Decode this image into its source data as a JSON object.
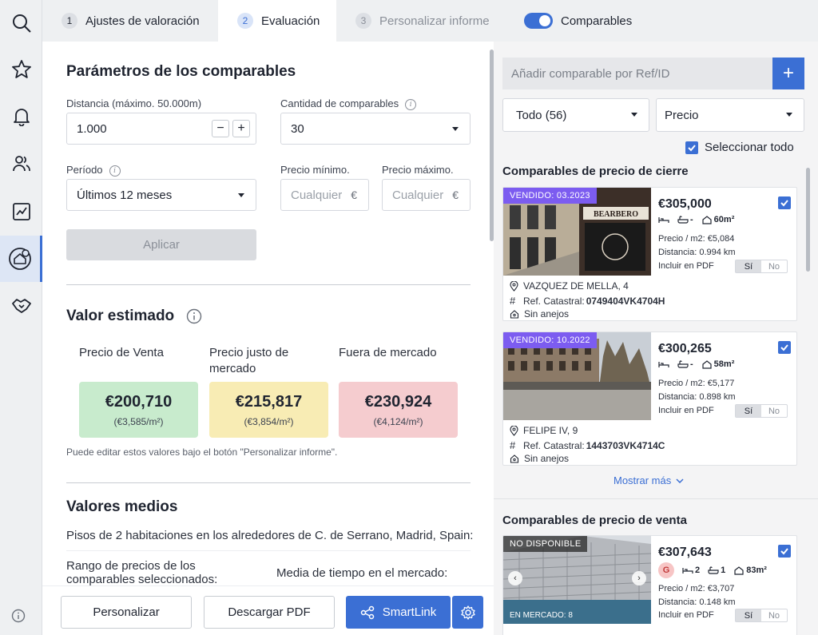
{
  "tabs": [
    {
      "num": "1",
      "label": "Ajustes de valoración"
    },
    {
      "num": "2",
      "label": "Evaluación"
    },
    {
      "num": "3",
      "label": "Personalizar informe"
    }
  ],
  "comparables_toggle": {
    "label": "Comparables",
    "on": true
  },
  "params": {
    "title": "Parámetros de los comparables",
    "distance_label": "Distancia (máximo. 50.000m)",
    "distance_value": "1.000",
    "count_label": "Cantidad de comparables",
    "count_value": "30",
    "period_label": "Período",
    "period_value": "Últimos 12 meses",
    "min_price_label": "Precio mínimo.",
    "max_price_label": "Precio máximo.",
    "min_price_placeholder": "Cualquier",
    "max_price_placeholder": "Cualquier",
    "currency": "€",
    "apply_label": "Aplicar"
  },
  "estimate": {
    "title": "Valor estimado",
    "columns": [
      {
        "label": "Precio de Venta",
        "value": "€200,710",
        "per_m2": "(€3,585/m²)",
        "color": "#c8ebcd"
      },
      {
        "label": "Precio justo de mercado",
        "value": "€215,817",
        "per_m2": "(€3,854/m²)",
        "color": "#f8ecb4"
      },
      {
        "label": "Fuera de mercado",
        "value": "€230,924",
        "per_m2": "(€4,124/m²)",
        "color": "#f5cccf"
      }
    ],
    "note": "Puede editar estos valores bajo el botón \"Personalizar informe\"."
  },
  "averages": {
    "title": "Valores medios",
    "subtitle": "Pisos de 2 habitaciones en los alrededores de C. de Serrano, Madrid, Spain:",
    "range_label": "Rango de precios de los comparables seleccionados:",
    "time_label": "Media de tiempo en el mercado:"
  },
  "footer": {
    "customize": "Personalizar",
    "download": "Descargar PDF",
    "smartlink": "SmartLink"
  },
  "right": {
    "add_placeholder": "Añadir comparable por Ref/ID",
    "filter_value": "Todo (56)",
    "sort_value": "Precio",
    "select_all": "Seleccionar todo",
    "closing_title": "Comparables de precio de cierre",
    "show_more": "Mostrar más",
    "sale_title": "Comparables de precio de venta",
    "pdf_label": "Incluir en PDF",
    "yes": "Sí",
    "no": "No",
    "closing_cards": [
      {
        "badge": "VENDIDO: 03.2023",
        "price": "€305,000",
        "beds": "",
        "baths": "-",
        "area": "60m²",
        "price_m2": "Precio / m2: €5,084",
        "distance": "Distancia: 0.994 km",
        "address": "VAZQUEZ DE MELLA, 4",
        "cadastral_label": "Ref. Catastral:",
        "cadastral": "0749404VK4704H",
        "annex": "Sin anejos",
        "sign": "BEARBERO"
      },
      {
        "badge": "VENDIDO: 10.2022",
        "price": "€300,265",
        "beds": "",
        "baths": "-",
        "area": "58m²",
        "price_m2": "Precio / m2: €5,177",
        "distance": "Distancia: 0.898 km",
        "address": "FELIPE IV, 9",
        "cadastral_label": "Ref. Catastral:",
        "cadastral": "1443703VK4714C",
        "annex": "Sin anejos"
      }
    ],
    "sale_cards": [
      {
        "badge": "NO DISPONIBLE",
        "price": "€307,643",
        "grade": "G",
        "beds": "2",
        "baths": "1",
        "area": "83m²",
        "price_m2": "Precio / m2: €3,707",
        "distance": "Distancia: 0.148 km",
        "photo_caption": "EN MERCADO: 8"
      }
    ]
  }
}
